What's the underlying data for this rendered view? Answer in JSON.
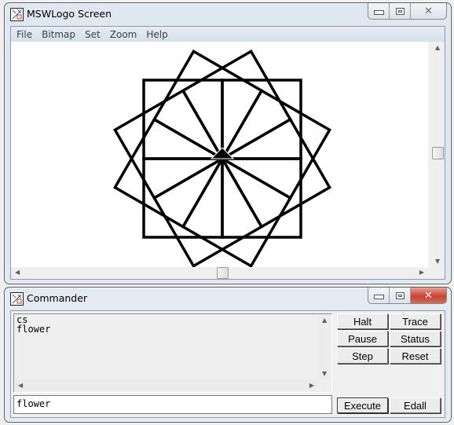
{
  "main_window": {
    "title": "MSWLogo Screen",
    "icon": "logo-app-icon",
    "caption_buttons": [
      "minimize",
      "maximize",
      "close"
    ],
    "menu": [
      "File",
      "Bitmap",
      "Set",
      "Zoom",
      "Help"
    ],
    "drawing": {
      "description": "Flower of 12 squares rotated every 30 degrees around the turtle home position",
      "square_count": 12,
      "rotation_step_degrees": 30,
      "square_side_turtle_steps": 100,
      "pen_color": "#000000",
      "turtle_visible": true
    }
  },
  "commander": {
    "title": "Commander",
    "icon": "logo-app-icon",
    "history_lines": [
      "cs",
      "flower"
    ],
    "input_value": "flower",
    "buttons": {
      "halt": "Halt",
      "trace": "Trace",
      "pause": "Pause",
      "status": "Status",
      "step": "Step",
      "reset": "Reset",
      "execute": "Execute",
      "edall": "Edall"
    }
  }
}
